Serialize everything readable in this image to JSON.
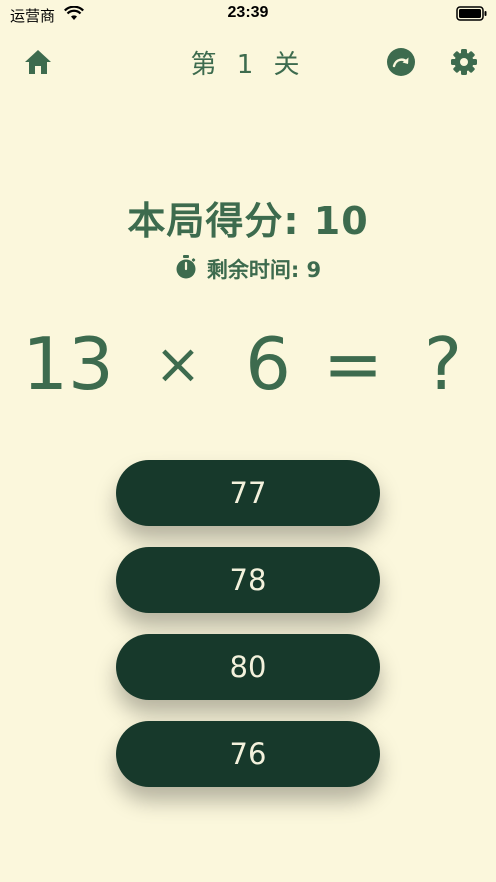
{
  "status_bar": {
    "carrier": "运营商",
    "time": "23:39"
  },
  "nav": {
    "level_title": "第 1 关",
    "icons": [
      "home-icon",
      "refresh-icon",
      "gear-icon"
    ]
  },
  "game": {
    "score_label": "本局得分: 10",
    "timer_label": "剩余时间: 9",
    "equation": {
      "operand_a": "13",
      "operator": "×",
      "operand_b": "6",
      "equals": "=",
      "unknown": "?"
    },
    "answers": [
      "77",
      "78",
      "80",
      "76"
    ]
  },
  "colors": {
    "background": "#fbf7dc",
    "primary": "#3d6b4e",
    "button_bg": "#17392b",
    "button_text": "#f3f1dc"
  }
}
